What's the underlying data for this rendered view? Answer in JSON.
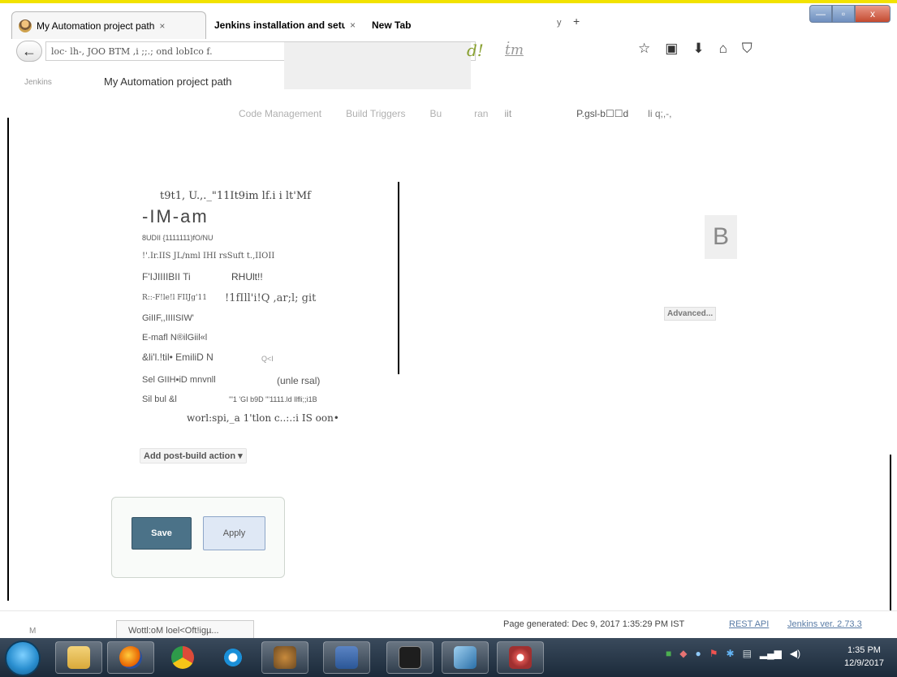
{
  "browser": {
    "tabs": [
      {
        "title": "My Automation project path",
        "close": "×"
      },
      {
        "title": "Jenkins installation and setup",
        "close": "×"
      },
      {
        "title": "New Tab",
        "close": ""
      }
    ],
    "new_tab_symbol": "+",
    "tab_dropdown_symbol": "y",
    "url_text": "loc· lh-,        JOO BTM ,i ;;.; ond lobIco f.",
    "url_marker_1": "d!",
    "url_marker_2": "ṫm",
    "window_buttons": {
      "minimize": "—",
      "maximize": "▫",
      "close": "x"
    },
    "toolbar_icons": [
      "☆",
      "▣",
      "⬇",
      "⌂",
      "⛉"
    ],
    "back_symbol": "←"
  },
  "page": {
    "breadcrumb": "Jenkins",
    "heading": "My Automation project path",
    "config_tabs": [
      "Code Management",
      "Build Triggers",
      "Bu",
      "ran",
      "iit",
      "P.gsl-b☐☐d",
      "li q;,-,"
    ]
  },
  "post_build_list": {
    "items": [
      "t9t1, U.,._\"11It9im lf.i i lt'Mf",
      "-IM-am",
      "8UDII  {1111111)fO/NU",
      "!'.Ir.IIS JL/nml IHI rsSuft t.,IIOII",
      "F'IJIIIIBII Ti",
      "RHUlt!!",
      "R::-F!le!l FIIJg'11",
      "!1fIll'i!Q ,ar;l; git",
      "GiIIF,,IIIISIW'",
      "E-mafl N®ilGiil«l",
      "&li'l.!til• EmiliD N",
      "Q<I",
      "Sel GIIH▪iD mnvnll",
      "(unle rsal)",
      "Sil  bul  &l",
      "'\"1 'GI   b9D \"'1111.ld llfli;;i1B",
      "worl:spi,_a 1'tlon c..:.:i IS oon•"
    ],
    "add_action_label": "Add post-build action",
    "add_action_arrow": "▾"
  },
  "right_panel": {
    "help_letter": "B",
    "advanced_label": "Advanced..."
  },
  "actions": {
    "save_label": "Save",
    "apply_label": "Apply"
  },
  "footer": {
    "left_letter": "M",
    "status_text": "Wottl:oM loel<Oft!igµ...",
    "page_generated": "Page generated: Dec 9, 2017 1:35:29 PM IST",
    "rest_api": "REST API",
    "jenkins_version": "Jenkins ver. 2.73.3"
  },
  "taskbar": {
    "clock_time": "1:35 PM",
    "clock_date": "12/9/2017",
    "apps": [
      "file-explorer",
      "firefox",
      "chrome",
      "internet-explorer",
      "gimp",
      "word",
      "terminal",
      "notes",
      "snipping-tool"
    ],
    "colors": {
      "firefox": "#e66000",
      "chrome": "#dd4b39",
      "ie": "#1a8fd8",
      "word": "#2b5797"
    }
  }
}
